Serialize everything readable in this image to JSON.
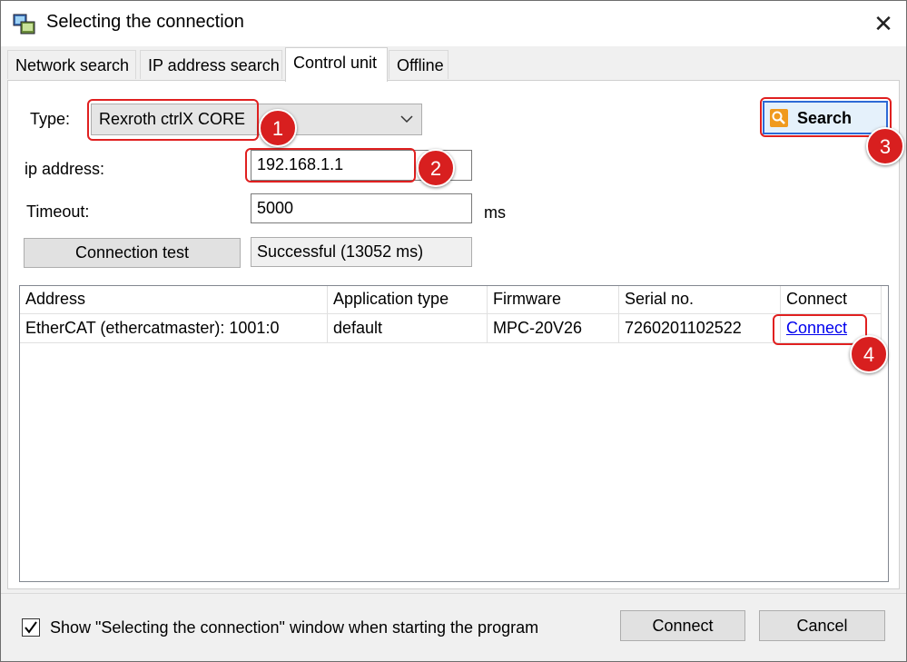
{
  "window": {
    "title": "Selecting the connection",
    "close_glyph": "✕"
  },
  "tabs": [
    {
      "label": "Network search",
      "active": false
    },
    {
      "label": "IP address search",
      "active": false
    },
    {
      "label": "Control unit",
      "active": true
    },
    {
      "label": "Offline",
      "active": false
    }
  ],
  "form": {
    "type_label": "Type:",
    "type_value": "Rexroth ctrlX CORE",
    "ip_label": "ip address:",
    "ip_value": "192.168.1.1",
    "timeout_label": "Timeout:",
    "timeout_value": "5000",
    "timeout_unit": "ms",
    "connection_test_label": "Connection test",
    "connection_test_result": "Successful (13052 ms)",
    "search_label": "Search"
  },
  "table": {
    "columns": [
      "Address",
      "Application type",
      "Firmware",
      "Serial no.",
      "Connect"
    ],
    "rows": [
      {
        "address": "EtherCAT (ethercatmaster): 1001:0",
        "app_type": "default",
        "firmware": "MPC-20V26",
        "serial": "7260201102522",
        "connect": "Connect"
      }
    ]
  },
  "footer": {
    "show_window_checked": true,
    "show_window_label": "Show \"Selecting the connection\" window when starting the program",
    "connect_label": "Connect",
    "cancel_label": "Cancel"
  },
  "annotations": [
    "1",
    "2",
    "3",
    "4"
  ],
  "colors": {
    "annotation_red": "#d81f1f",
    "link_blue": "#0000ee",
    "search_border": "#2d6ad6"
  }
}
